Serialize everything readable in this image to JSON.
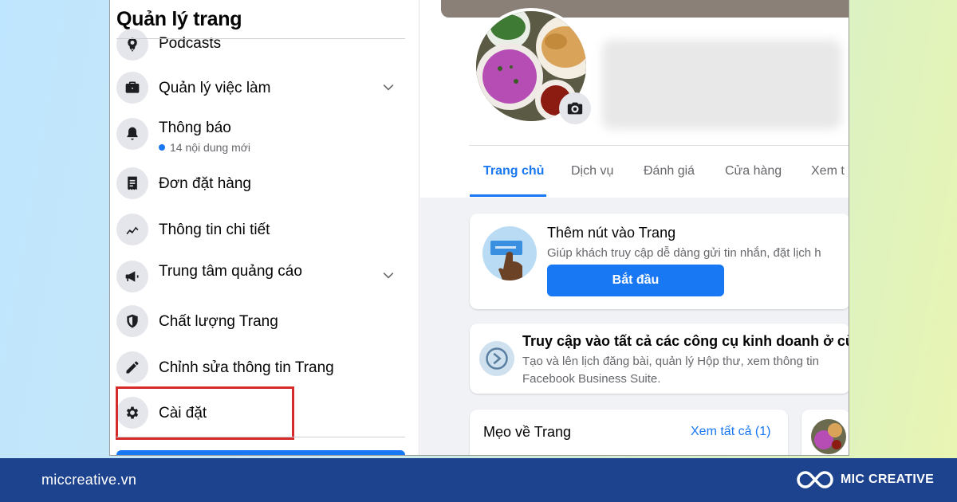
{
  "sidebar": {
    "title": "Quản lý trang",
    "items": [
      {
        "label": "Podcasts",
        "icon": "podcast-icon"
      },
      {
        "label": "Quản lý việc làm",
        "icon": "briefcase-icon",
        "expandable": true
      },
      {
        "label": "Thông báo",
        "icon": "bell-icon",
        "sub": "14 nội dung mới"
      },
      {
        "label": "Đơn đặt hàng",
        "icon": "receipt-icon"
      },
      {
        "label": "Thông tin chi tiết",
        "icon": "insights-icon"
      },
      {
        "label": "Trung tâm quảng cáo",
        "icon": "megaphone-icon",
        "expandable": true
      },
      {
        "label": "Chất lượng Trang",
        "icon": "shield-icon"
      },
      {
        "label": "Chỉnh sửa thông tin Trang",
        "icon": "pencil-icon"
      },
      {
        "label": "Cài đặt",
        "icon": "gear-icon",
        "highlighted": true
      }
    ],
    "highlight_color": "#d52b2b"
  },
  "page": {
    "tabs": [
      "Trang chủ",
      "Dịch vụ",
      "Đánh giá",
      "Cửa hàng",
      "Xem t"
    ],
    "active_tab": "Trang chủ",
    "add_button_card": {
      "title": "Thêm nút vào Trang",
      "text": "Giúp khách truy cập dễ dàng gửi tin nhắn, đặt lịch h",
      "button": "Bắt đầu"
    },
    "business_suite_card": {
      "title": "Truy cập vào tất cả các công cụ kinh doanh ở cù",
      "line1": "Tạo và lên lịch đăng bài, quản lý Hộp thư, xem thông tin",
      "line2": "Facebook Business Suite."
    },
    "tips_card": {
      "title": "Mẹo về Trang",
      "link": "Xem tất cả (1)"
    }
  },
  "footer": {
    "url": "miccreative.vn",
    "brand": "MIC CREATIVE"
  },
  "colors": {
    "accent": "#1877f2",
    "footer_bg": "#1e438e"
  }
}
